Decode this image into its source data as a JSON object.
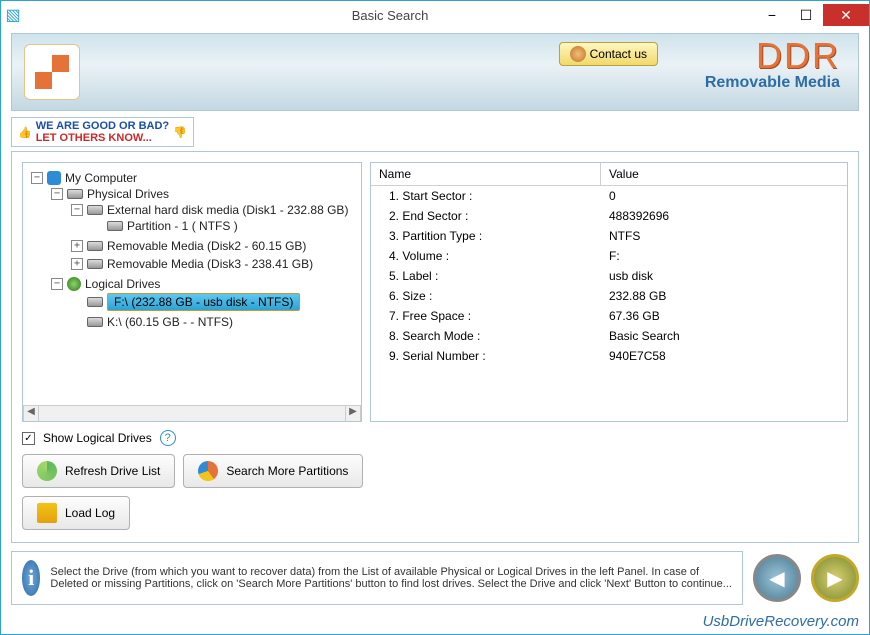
{
  "window": {
    "title": "Basic Search"
  },
  "banner": {
    "contact": "Contact us",
    "brand": "DDR",
    "brand_sub": "Removable Media"
  },
  "feedback": {
    "line1": "WE ARE GOOD OR BAD?",
    "line2": "LET OTHERS KNOW..."
  },
  "tree": {
    "root": "My Computer",
    "physical": "Physical Drives",
    "phys_items": [
      {
        "label": "External hard disk media (Disk1 - 232.88 GB)",
        "child": "Partition - 1 ( NTFS )",
        "exp": "−"
      },
      {
        "label": "Removable Media (Disk2 - 60.15 GB)",
        "exp": "+"
      },
      {
        "label": "Removable Media (Disk3 - 238.41 GB)",
        "exp": "+"
      }
    ],
    "logical": "Logical Drives",
    "log_items": [
      {
        "label": "F:\\ (232.88 GB - usb disk - NTFS)",
        "selected": true
      },
      {
        "label": "K:\\ (60.15 GB -  - NTFS)",
        "selected": false
      }
    ]
  },
  "properties": {
    "headers": {
      "name": "Name",
      "value": "Value"
    },
    "rows": [
      {
        "name": "Start Sector :",
        "value": "0"
      },
      {
        "name": "End Sector :",
        "value": "488392696"
      },
      {
        "name": "Partition Type :",
        "value": "NTFS"
      },
      {
        "name": "Volume :",
        "value": "F:"
      },
      {
        "name": "Label :",
        "value": "usb disk"
      },
      {
        "name": "Size :",
        "value": "232.88 GB"
      },
      {
        "name": "Free Space :",
        "value": "67.36 GB"
      },
      {
        "name": "Search Mode :",
        "value": "Basic Search"
      },
      {
        "name": "Serial Number :",
        "value": "940E7C58"
      }
    ]
  },
  "controls": {
    "show_logical": "Show Logical Drives",
    "refresh": "Refresh Drive List",
    "search_more": "Search More Partitions",
    "load_log": "Load Log"
  },
  "info": "Select the Drive (from which you want to recover data) from the List of available Physical or Logical Drives in the left Panel. In case of Deleted or missing Partitions, click on 'Search More Partitions' button to find lost drives. Select the Drive and click 'Next' Button to continue...",
  "url": "UsbDriveRecovery.com"
}
